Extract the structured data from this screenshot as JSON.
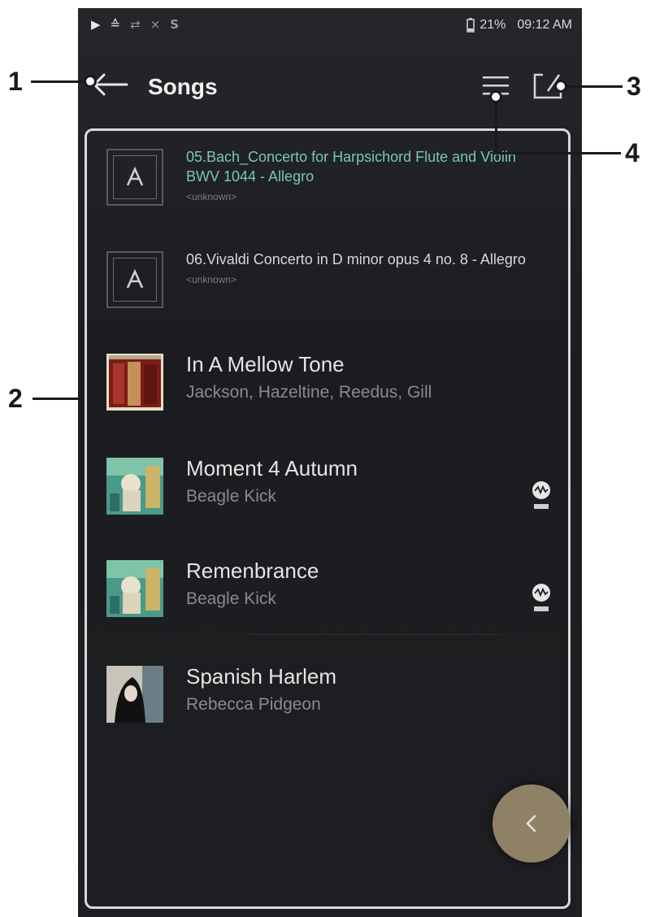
{
  "status_bar": {
    "play_icon": "play-icon",
    "battery_pct": "21%",
    "time": "09:12 AM"
  },
  "header": {
    "title": "Songs"
  },
  "songs": [
    {
      "title": "05.Bach_Concerto for Harpsichord Flute and Violin BWV 1044 - Allegro",
      "artist": "<unknown>",
      "thumb": "astell-logo"
    },
    {
      "title": "06.Vivaldi Concerto in D minor opus 4 no. 8 - Allegro",
      "artist": "<unknown>",
      "thumb": "astell-logo"
    },
    {
      "title": "In A Mellow Tone",
      "artist": "Jackson, Hazeltine, Reedus, Gill",
      "thumb": "album-art-red"
    },
    {
      "title": "Moment 4 Autumn",
      "artist": "Beagle Kick",
      "thumb": "album-art-green",
      "badge": "mqa"
    },
    {
      "title": "Remenbrance",
      "artist": "Beagle Kick",
      "thumb": "album-art-green",
      "badge": "mqa"
    },
    {
      "title": "Spanish Harlem",
      "artist": "Rebecca Pidgeon",
      "thumb": "album-art-portrait"
    }
  ],
  "callouts": [
    "1",
    "2",
    "3",
    "4"
  ],
  "colors": {
    "background": "#1c1d20",
    "playing_accent": "#79c6b4",
    "fab": "#8f8166"
  }
}
